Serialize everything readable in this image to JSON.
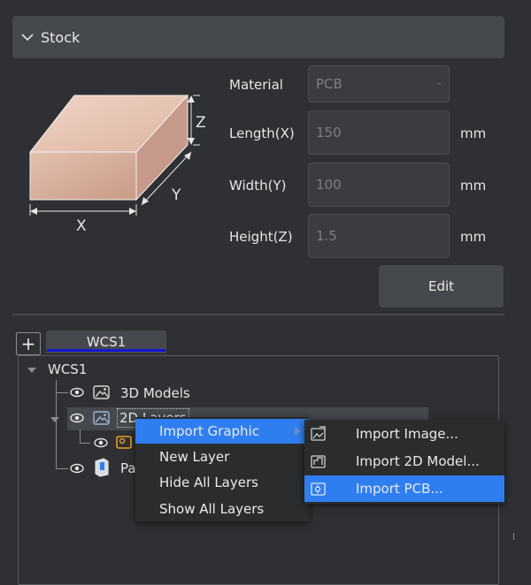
{
  "stock": {
    "header_label": "Stock",
    "diagram": {
      "x_label": "X",
      "y_label": "Y",
      "z_label": "Z"
    },
    "material_label": "Material",
    "material_value": "PCB",
    "length_label": "Length(X)",
    "length_value": "150",
    "width_label": "Width(Y)",
    "width_value": "100",
    "height_label": "Height(Z)",
    "height_value": "1.5",
    "unit": "mm",
    "edit_label": "Edit"
  },
  "tabs": {
    "add_label": "+",
    "items": [
      {
        "label": "WCS1"
      }
    ]
  },
  "tree": {
    "root_label": "WCS1",
    "items": [
      {
        "label": "3D Models",
        "icon": "image-icon"
      },
      {
        "label": "2D Layers",
        "icon": "image-icon"
      },
      {
        "label": "",
        "icon": "layer-icon"
      },
      {
        "label": "Pa",
        "icon": "part-icon"
      }
    ]
  },
  "context_menu": {
    "items": [
      {
        "label": "Import Graphic",
        "has_submenu": true
      },
      {
        "label": "New Layer"
      },
      {
        "label": "Hide All Layers"
      },
      {
        "label": "Show All Layers"
      }
    ]
  },
  "submenu": {
    "items": [
      {
        "label": "Import Image...",
        "icon": "import-image-icon"
      },
      {
        "label": "Import 2D Model...",
        "icon": "import-2d-model-icon"
      },
      {
        "label": "Import PCB...",
        "icon": "import-pcb-icon"
      }
    ]
  },
  "colors": {
    "background": "#2e3033",
    "panel": "#45484c",
    "highlight": "#2f7ef0",
    "tab_underline": "#1515d8",
    "stock_box": "#d8b0a0"
  }
}
